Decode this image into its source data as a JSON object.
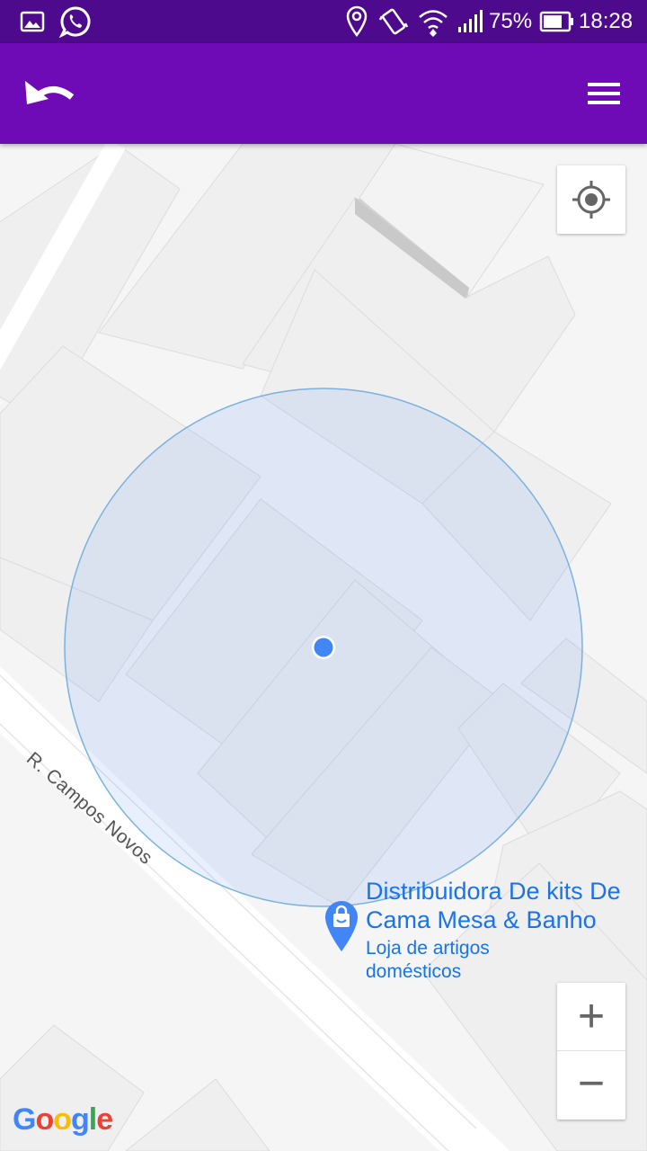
{
  "status_bar": {
    "battery_percent": "75%",
    "time": "18:28",
    "icons": [
      "gallery-icon",
      "whatsapp-icon",
      "location-icon",
      "vibrate-icon",
      "wifi-icon",
      "signal-icon",
      "battery-icon"
    ]
  },
  "app_bar": {
    "back_icon": "undo-arrow-icon",
    "menu_icon": "hamburger-menu-icon",
    "background": "#6f0bb6"
  },
  "map": {
    "street_label": "R. Campos Novos",
    "place": {
      "name": "Distribuidora De kits De Cama Mesa & Banho",
      "category": "Loja de artigos domésticos",
      "marker_icon": "shopping-bag-marker-icon"
    },
    "my_location_button_icon": "my-location-crosshair-icon",
    "zoom_in_label": "+",
    "zoom_out_label": "−",
    "attribution": {
      "letters": [
        "G",
        "o",
        "o",
        "g",
        "l",
        "e"
      ],
      "colors": [
        "#4285f4",
        "#ea4335",
        "#fbbc05",
        "#4285f4",
        "#34a853",
        "#ea4335"
      ]
    },
    "accuracy_circle_color": "#4285f4"
  }
}
